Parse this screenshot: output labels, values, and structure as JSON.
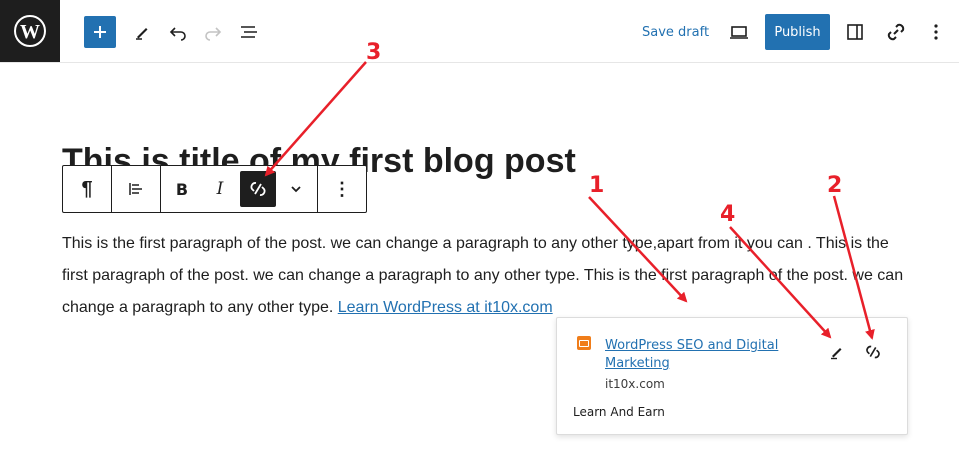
{
  "header": {
    "save_draft": "Save draft",
    "publish": "Publish"
  },
  "post": {
    "title": "This is title of my first blog post",
    "paragraph_text": "This is the first paragraph of the post. we can change a paragraph to any other type,apart from it you can . This is the first paragraph of the post. we can change a paragraph to any other type. This is the first paragraph of the post. we can change a paragraph to any other type. ",
    "link_text": "Learn WordPress at it10x.com"
  },
  "toolbar": {
    "paragraph_glyph": "¶",
    "bold": "B",
    "italic": "I",
    "more": "⋮"
  },
  "popover": {
    "title": "WordPress SEO and Digital Marketing",
    "domain": "it10x.com",
    "description": "Learn And Earn"
  },
  "annotations": [
    "1",
    "2",
    "3",
    "4"
  ],
  "colors": {
    "accent": "#2271b1",
    "annotation": "#e8202a",
    "dark": "#1e1e1e"
  }
}
